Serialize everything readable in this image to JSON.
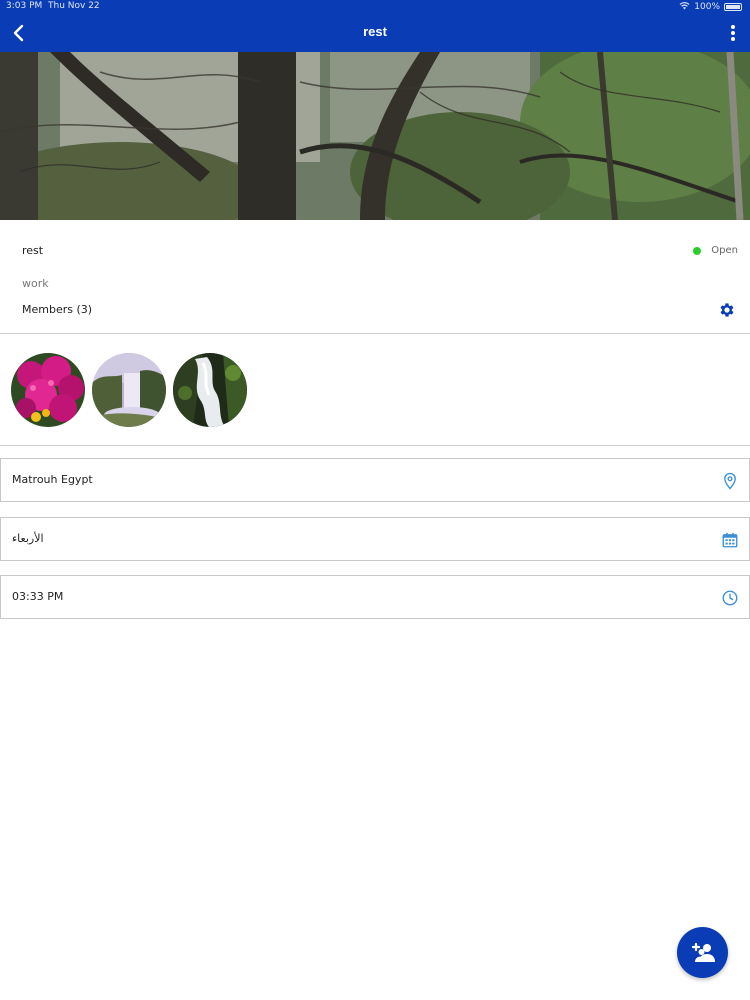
{
  "status_bar": {
    "time": "3:03 PM",
    "date": "Thu Nov 22",
    "battery": "100%"
  },
  "nav": {
    "title": "rest"
  },
  "group": {
    "name": "rest",
    "status_label": "Open",
    "status_color": "#28d02a",
    "description": "work",
    "members_label": "Members (3)"
  },
  "members": [
    {
      "icon": "flower-avatar"
    },
    {
      "icon": "waterfall-avatar"
    },
    {
      "icon": "cascade-avatar"
    }
  ],
  "fields": {
    "location": {
      "value": "Matrouh Egypt",
      "icon": "location-pin-icon"
    },
    "day": {
      "value": "الأربعاء",
      "icon": "calendar-icon"
    },
    "time": {
      "value": "03:33 PM",
      "icon": "clock-icon"
    }
  },
  "colors": {
    "primary": "#0a3db5",
    "icon_blue": "#3a8fd6"
  }
}
